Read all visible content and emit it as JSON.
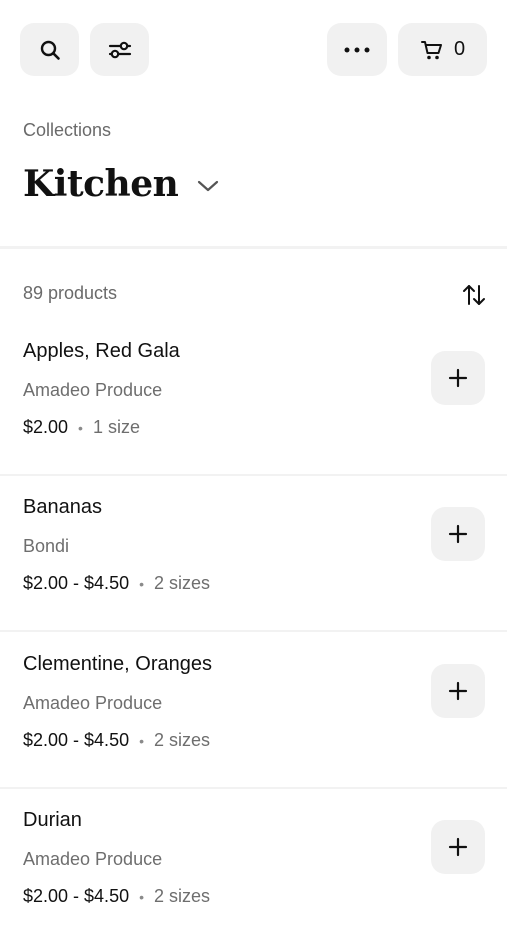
{
  "topbar": {
    "search_icon": "search-icon",
    "filter_icon": "sliders-icon",
    "more_icon": "more-horizontal-icon",
    "cart_icon": "cart-icon",
    "cart_count": "0"
  },
  "header": {
    "breadcrumb": "Collections",
    "title": "Kitchen"
  },
  "list": {
    "count_label": "89 products",
    "sort_icon": "sort-arrows-icon"
  },
  "products": [
    {
      "name": "Apples, Red Gala",
      "vendor": "Amadeo Produce",
      "price": "$2.00",
      "sizes": "1 size"
    },
    {
      "name": "Bananas",
      "vendor": "Bondi",
      "price": "$2.00 - $4.50",
      "sizes": "2 sizes"
    },
    {
      "name": "Clementine, Oranges",
      "vendor": "Amadeo Produce",
      "price": "$2.00 - $4.50",
      "sizes": "2 sizes"
    },
    {
      "name": "Durian",
      "vendor": "Amadeo Produce",
      "price": "$2.00 - $4.50",
      "sizes": "2 sizes"
    }
  ],
  "colors": {
    "button_bg": "#f1f1f1",
    "text_primary": "#111111",
    "text_secondary": "#6e6e6e",
    "divider": "#f2f2f2"
  }
}
